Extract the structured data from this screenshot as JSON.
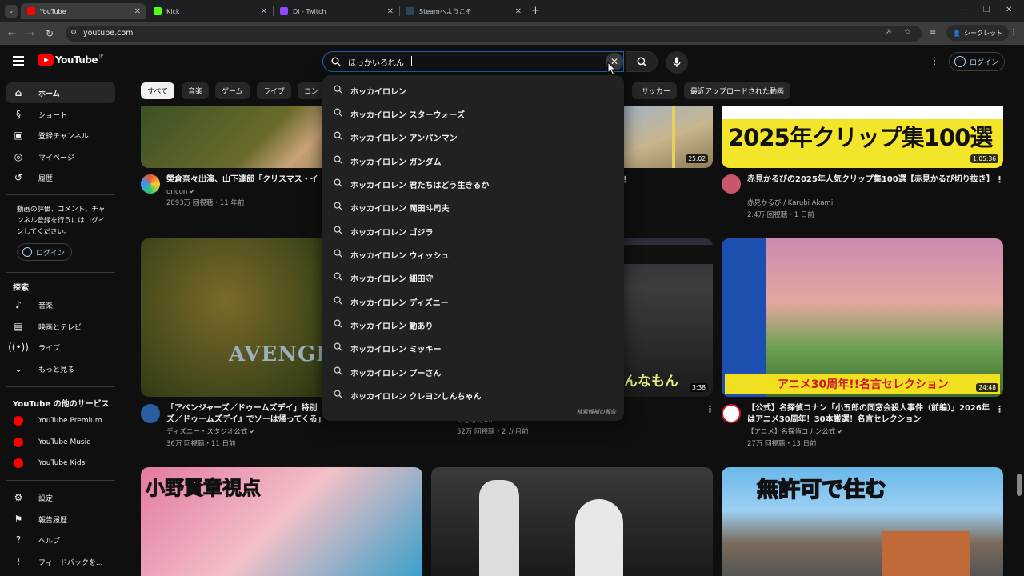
{
  "browser": {
    "tabs": [
      {
        "label": "YouTube",
        "color": "#ff0000"
      },
      {
        "label": "Kick",
        "color": "#53fc18"
      },
      {
        "label": "DJ - Twitch",
        "color": "#9146ff"
      },
      {
        "label": "Steamへようこそ",
        "color": "#1b2838"
      }
    ],
    "url": "youtube.com",
    "incognito_label": "シークレット"
  },
  "youtube": {
    "logo_text": "YouTube",
    "region": "JP",
    "search_value": "ほっかいろれん",
    "login_label": "ログイン"
  },
  "sidebar": {
    "main": [
      {
        "label": "ホーム",
        "icon": "home-icon"
      },
      {
        "label": "ショート",
        "icon": "shorts-icon"
      },
      {
        "label": "登録チャンネル",
        "icon": "subscriptions-icon"
      },
      {
        "label": "マイページ",
        "icon": "you-icon"
      },
      {
        "label": "履歴",
        "icon": "history-icon"
      }
    ],
    "signin_prompt": "動画の評価、コメント、チャンネル登録を行うにはログインしてください。",
    "signin_label": "ログイン",
    "explore_title": "探索",
    "explore": [
      {
        "label": "音楽"
      },
      {
        "label": "映画とテレビ"
      },
      {
        "label": "ライブ"
      },
      {
        "label": "もっと見る"
      }
    ],
    "more_title": "YouTube の他のサービス",
    "more": [
      {
        "label": "YouTube Premium"
      },
      {
        "label": "YouTube Music"
      },
      {
        "label": "YouTube Kids"
      }
    ],
    "footer": [
      {
        "label": "設定"
      },
      {
        "label": "報告履歴"
      },
      {
        "label": "ヘルプ"
      },
      {
        "label": "フィードバックを..."
      }
    ]
  },
  "chips": [
    "すべて",
    "音楽",
    "ゲーム",
    "ライブ",
    "コン",
    "サッカー",
    "最近アップロードされた動画"
  ],
  "videos": [
    {
      "title": "榮倉奈々出演、山下達郎「クリスマス・イ",
      "channel": "oricon",
      "stats": "2093万 回視聴・11 年前"
    },
    {
      "title": "",
      "channel": "",
      "stats": "",
      "duration": "25:02"
    },
    {
      "title": "赤見かるびの2025年人気クリップ集100選【赤見かるび切り抜き】",
      "channel": "赤見かるび / Karubi Akami",
      "stats": "2.4万 回視聴・1 日前",
      "duration": "1:05:36",
      "thumb_text": "2025年クリップ集100選"
    },
    {
      "title": "「アベンジャーズ／ドゥームズデイ」特別ズ／ドゥームズデイ』でソーは帰ってくる」｜2026年12月18...",
      "channel": "ディズニー・スタジオ公式",
      "stats": "36万 回視聴・11 日前",
      "thumb_text": "AVENGERS"
    },
    {
      "title": "",
      "channel": "のきなた46",
      "stats": "52万 回視聴・2 か月前",
      "duration": "3:38",
      "thumb_text": "んなもん"
    },
    {
      "title": "【公式】名探偵コナン「小五郎の同窓会殺人事件（前編）」2026年はアニメ30周年！30本厳選！名言セレクション",
      "channel": "【アニメ】名探偵コナン公式",
      "stats": "27万 回視聴・13 日前",
      "duration": "24:48",
      "thumb_text": "アニメ30周年!!名言セレクション"
    },
    {
      "thumb_text": "小野賢章視点"
    },
    {
      "thumb_text": ""
    },
    {
      "thumb_text": "無許可で住む"
    }
  ],
  "suggestions": [
    "ホッカイロレン",
    "ホッカイロレン スターウォーズ",
    "ホッカイロレン アンパンマン",
    "ホッカイロレン ガンダム",
    "ホッカイロレン 君たちはどう生きるか",
    "ホッカイロレン 岡田斗司夫",
    "ホッカイロレン ゴジラ",
    "ホッカイロレン ウィッシュ",
    "ホッカイロレン 細田守",
    "ホッカイロレン ディズニー",
    "ホッカイロレン 動あり",
    "ホッカイロレン ミッキー",
    "ホッカイロレン プーさん",
    "ホッカイロレン クレヨンしんちゃん"
  ],
  "suggest_report": "検索候補の報告"
}
